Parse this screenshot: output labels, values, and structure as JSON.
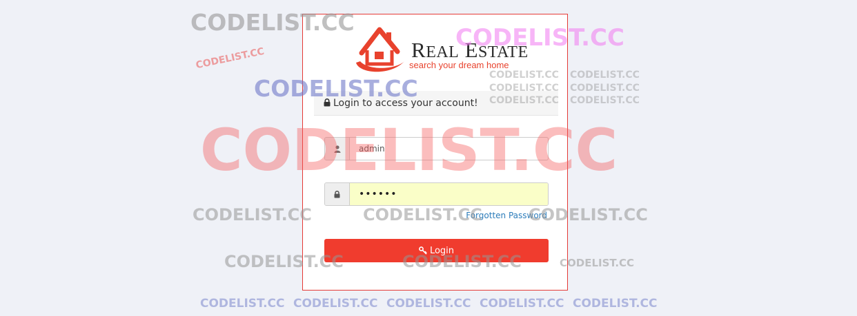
{
  "brand": {
    "title_first_initial": "R",
    "title_first_rest": "EAL",
    "title_second_initial": "E",
    "title_second_rest": "STATE",
    "tagline": "search your dream home"
  },
  "login": {
    "header": "Login to access your account!",
    "username_value": "admin",
    "password_value": "••••••",
    "forgot_label": "Forgotten Password",
    "button_label": "Login"
  },
  "watermark": {
    "text": "CODELIST.CC"
  },
  "colors": {
    "accent": "#f03c2e",
    "link": "#2c7cba",
    "border": "#e53935",
    "autofill": "#fafec8"
  },
  "icons": {
    "logo": "house-swoosh-logo",
    "header": "lock-icon",
    "username": "user-icon",
    "password": "lock-icon",
    "button": "key-icon"
  }
}
